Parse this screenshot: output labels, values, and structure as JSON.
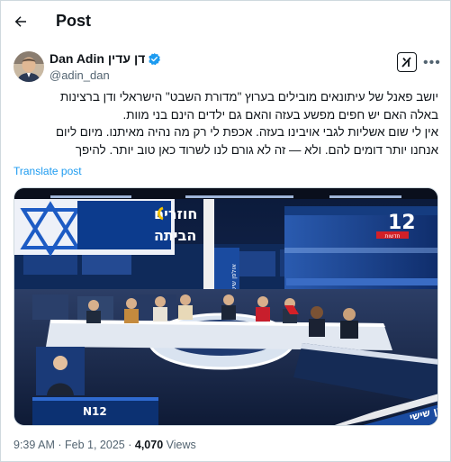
{
  "header": {
    "title": "Post"
  },
  "author": {
    "display_name": "Dan Adin דן עדין",
    "handle": "@adin_dan",
    "verified": true
  },
  "tweet": {
    "lines": [
      "יושב פאנל של עיתונאים מובילים בערוץ \"מדורת השבט\" הישראלי ודן ברצינות",
      "באלה האם יש חפים מפשע בעזה והאם גם ילדים הינם בני מוות.",
      "אין לי שום אשליות לגבי אויבינו בעזה. אכפת לי רק מה נהיה מאיתנו. מיום ליום",
      "אנחנו יותר דומים להם. ולא — זה לא גורם לנו לשרוד כאן טוב יותר. להיפך"
    ],
    "translate_label": "Translate post"
  },
  "media": {
    "banner_line1": "חוזרים",
    "banner_line2": "הביתה",
    "channel_logo": "12",
    "channel_sub": "חדשות",
    "lower_third": "אולפן שישי",
    "corner_badge": "N12",
    "desk_text": "אולפן שישי",
    "colors": {
      "studio_blue": "#1c4c9a",
      "banner_white": "#f4f6fb",
      "desk_white": "#e9eef5",
      "red_accent": "#d32027"
    }
  },
  "meta": {
    "time": "9:39 AM",
    "separator": "·",
    "date": "Feb 1, 2025",
    "views_count": "4,070",
    "views_label": "Views"
  },
  "icons": {
    "back": "arrow-left-icon",
    "verified": "verified-badge-icon",
    "grok": "grok-icon",
    "more": "more-icon"
  }
}
